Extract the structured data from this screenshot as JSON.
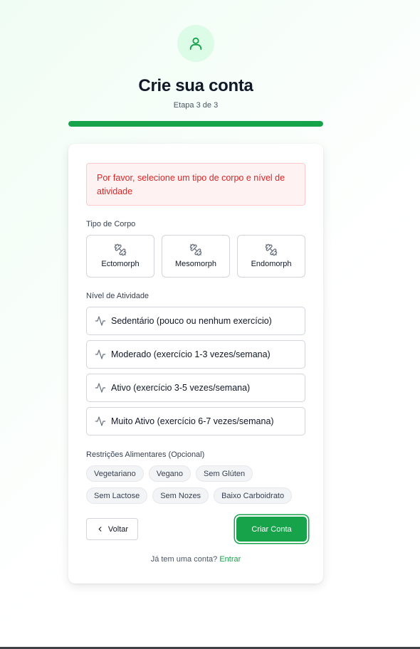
{
  "header": {
    "icon": "user-icon",
    "title": "Crie sua conta",
    "step": "Etapa 3 de 3",
    "progress_fraction": 1.0,
    "accent_color": "#16a34a"
  },
  "form": {
    "error_message": "Por favor, selecione um tipo de corpo e nível de atividade",
    "body_type_label": "Tipo de Corpo",
    "body_types": [
      {
        "label": "Ectomorph",
        "icon": "dumbbell-icon"
      },
      {
        "label": "Mesomorph",
        "icon": "dumbbell-icon"
      },
      {
        "label": "Endomorph",
        "icon": "dumbbell-icon"
      }
    ],
    "activity_label": "Nível de Atividade",
    "activities": [
      {
        "label": "Sedentário (pouco ou nenhum exercício)",
        "icon": "activity-icon"
      },
      {
        "label": "Moderado (exercício 1-3 vezes/semana)",
        "icon": "activity-icon"
      },
      {
        "label": "Ativo (exercício 3-5 vezes/semana)",
        "icon": "activity-icon"
      },
      {
        "label": "Muito Ativo (exercício 6-7 vezes/semana)",
        "icon": "activity-icon"
      }
    ],
    "restrictions_label": "Restrições Alimentares (Opcional)",
    "restrictions": [
      "Vegetariano",
      "Vegano",
      "Sem Glúten",
      "Sem Lactose",
      "Sem Nozes",
      "Baixo Carboidrato"
    ],
    "back_label": "Voltar",
    "submit_label": "Criar Conta",
    "login_prompt": "Já tem uma conta?",
    "login_link": "Entrar"
  }
}
